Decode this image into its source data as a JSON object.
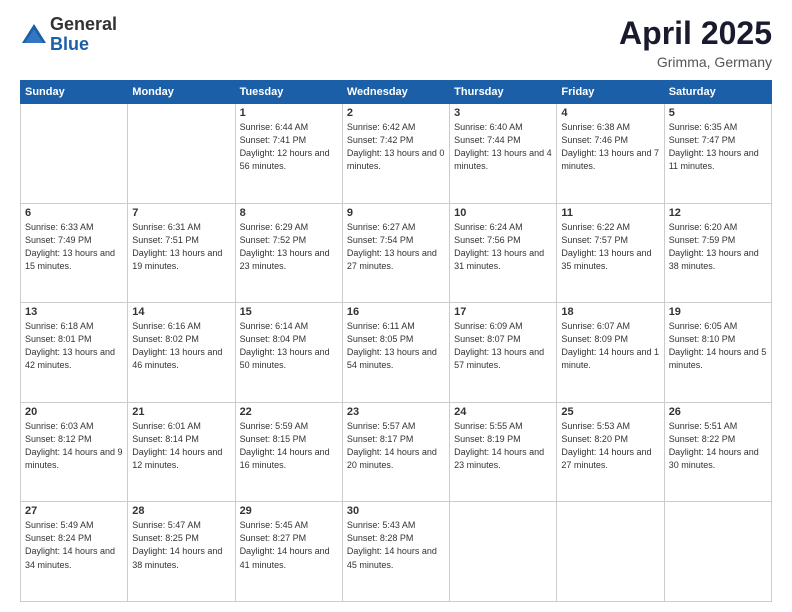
{
  "header": {
    "logo_general": "General",
    "logo_blue": "Blue",
    "month_title": "April 2025",
    "location": "Grimma, Germany"
  },
  "weekdays": [
    "Sunday",
    "Monday",
    "Tuesday",
    "Wednesday",
    "Thursday",
    "Friday",
    "Saturday"
  ],
  "weeks": [
    [
      {
        "day": "",
        "sunrise": "",
        "sunset": "",
        "daylight": ""
      },
      {
        "day": "",
        "sunrise": "",
        "sunset": "",
        "daylight": ""
      },
      {
        "day": "1",
        "sunrise": "Sunrise: 6:44 AM",
        "sunset": "Sunset: 7:41 PM",
        "daylight": "Daylight: 12 hours and 56 minutes."
      },
      {
        "day": "2",
        "sunrise": "Sunrise: 6:42 AM",
        "sunset": "Sunset: 7:42 PM",
        "daylight": "Daylight: 13 hours and 0 minutes."
      },
      {
        "day": "3",
        "sunrise": "Sunrise: 6:40 AM",
        "sunset": "Sunset: 7:44 PM",
        "daylight": "Daylight: 13 hours and 4 minutes."
      },
      {
        "day": "4",
        "sunrise": "Sunrise: 6:38 AM",
        "sunset": "Sunset: 7:46 PM",
        "daylight": "Daylight: 13 hours and 7 minutes."
      },
      {
        "day": "5",
        "sunrise": "Sunrise: 6:35 AM",
        "sunset": "Sunset: 7:47 PM",
        "daylight": "Daylight: 13 hours and 11 minutes."
      }
    ],
    [
      {
        "day": "6",
        "sunrise": "Sunrise: 6:33 AM",
        "sunset": "Sunset: 7:49 PM",
        "daylight": "Daylight: 13 hours and 15 minutes."
      },
      {
        "day": "7",
        "sunrise": "Sunrise: 6:31 AM",
        "sunset": "Sunset: 7:51 PM",
        "daylight": "Daylight: 13 hours and 19 minutes."
      },
      {
        "day": "8",
        "sunrise": "Sunrise: 6:29 AM",
        "sunset": "Sunset: 7:52 PM",
        "daylight": "Daylight: 13 hours and 23 minutes."
      },
      {
        "day": "9",
        "sunrise": "Sunrise: 6:27 AM",
        "sunset": "Sunset: 7:54 PM",
        "daylight": "Daylight: 13 hours and 27 minutes."
      },
      {
        "day": "10",
        "sunrise": "Sunrise: 6:24 AM",
        "sunset": "Sunset: 7:56 PM",
        "daylight": "Daylight: 13 hours and 31 minutes."
      },
      {
        "day": "11",
        "sunrise": "Sunrise: 6:22 AM",
        "sunset": "Sunset: 7:57 PM",
        "daylight": "Daylight: 13 hours and 35 minutes."
      },
      {
        "day": "12",
        "sunrise": "Sunrise: 6:20 AM",
        "sunset": "Sunset: 7:59 PM",
        "daylight": "Daylight: 13 hours and 38 minutes."
      }
    ],
    [
      {
        "day": "13",
        "sunrise": "Sunrise: 6:18 AM",
        "sunset": "Sunset: 8:01 PM",
        "daylight": "Daylight: 13 hours and 42 minutes."
      },
      {
        "day": "14",
        "sunrise": "Sunrise: 6:16 AM",
        "sunset": "Sunset: 8:02 PM",
        "daylight": "Daylight: 13 hours and 46 minutes."
      },
      {
        "day": "15",
        "sunrise": "Sunrise: 6:14 AM",
        "sunset": "Sunset: 8:04 PM",
        "daylight": "Daylight: 13 hours and 50 minutes."
      },
      {
        "day": "16",
        "sunrise": "Sunrise: 6:11 AM",
        "sunset": "Sunset: 8:05 PM",
        "daylight": "Daylight: 13 hours and 54 minutes."
      },
      {
        "day": "17",
        "sunrise": "Sunrise: 6:09 AM",
        "sunset": "Sunset: 8:07 PM",
        "daylight": "Daylight: 13 hours and 57 minutes."
      },
      {
        "day": "18",
        "sunrise": "Sunrise: 6:07 AM",
        "sunset": "Sunset: 8:09 PM",
        "daylight": "Daylight: 14 hours and 1 minute."
      },
      {
        "day": "19",
        "sunrise": "Sunrise: 6:05 AM",
        "sunset": "Sunset: 8:10 PM",
        "daylight": "Daylight: 14 hours and 5 minutes."
      }
    ],
    [
      {
        "day": "20",
        "sunrise": "Sunrise: 6:03 AM",
        "sunset": "Sunset: 8:12 PM",
        "daylight": "Daylight: 14 hours and 9 minutes."
      },
      {
        "day": "21",
        "sunrise": "Sunrise: 6:01 AM",
        "sunset": "Sunset: 8:14 PM",
        "daylight": "Daylight: 14 hours and 12 minutes."
      },
      {
        "day": "22",
        "sunrise": "Sunrise: 5:59 AM",
        "sunset": "Sunset: 8:15 PM",
        "daylight": "Daylight: 14 hours and 16 minutes."
      },
      {
        "day": "23",
        "sunrise": "Sunrise: 5:57 AM",
        "sunset": "Sunset: 8:17 PM",
        "daylight": "Daylight: 14 hours and 20 minutes."
      },
      {
        "day": "24",
        "sunrise": "Sunrise: 5:55 AM",
        "sunset": "Sunset: 8:19 PM",
        "daylight": "Daylight: 14 hours and 23 minutes."
      },
      {
        "day": "25",
        "sunrise": "Sunrise: 5:53 AM",
        "sunset": "Sunset: 8:20 PM",
        "daylight": "Daylight: 14 hours and 27 minutes."
      },
      {
        "day": "26",
        "sunrise": "Sunrise: 5:51 AM",
        "sunset": "Sunset: 8:22 PM",
        "daylight": "Daylight: 14 hours and 30 minutes."
      }
    ],
    [
      {
        "day": "27",
        "sunrise": "Sunrise: 5:49 AM",
        "sunset": "Sunset: 8:24 PM",
        "daylight": "Daylight: 14 hours and 34 minutes."
      },
      {
        "day": "28",
        "sunrise": "Sunrise: 5:47 AM",
        "sunset": "Sunset: 8:25 PM",
        "daylight": "Daylight: 14 hours and 38 minutes."
      },
      {
        "day": "29",
        "sunrise": "Sunrise: 5:45 AM",
        "sunset": "Sunset: 8:27 PM",
        "daylight": "Daylight: 14 hours and 41 minutes."
      },
      {
        "day": "30",
        "sunrise": "Sunrise: 5:43 AM",
        "sunset": "Sunset: 8:28 PM",
        "daylight": "Daylight: 14 hours and 45 minutes."
      },
      {
        "day": "",
        "sunrise": "",
        "sunset": "",
        "daylight": ""
      },
      {
        "day": "",
        "sunrise": "",
        "sunset": "",
        "daylight": ""
      },
      {
        "day": "",
        "sunrise": "",
        "sunset": "",
        "daylight": ""
      }
    ]
  ]
}
